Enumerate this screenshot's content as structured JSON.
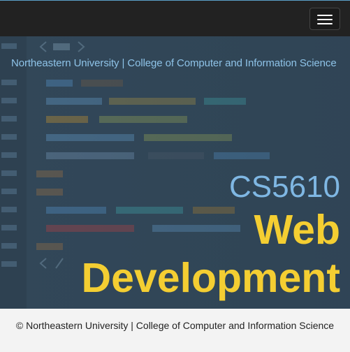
{
  "navbar": {
    "menu_toggle_icon": "hamburger-menu-icon"
  },
  "hero": {
    "tagline": "Northeastern University | College of Computer and Information Science",
    "course_code": "CS5610",
    "title_line1": "Web",
    "title_line2": "Development",
    "colors": {
      "tagline": "#8ec3e8",
      "course_code": "#7fb7e3",
      "title": "#f4ce32",
      "background": "#33495b"
    }
  },
  "footer": {
    "copyright": "© Northeastern University | College of Computer and Information Science"
  }
}
